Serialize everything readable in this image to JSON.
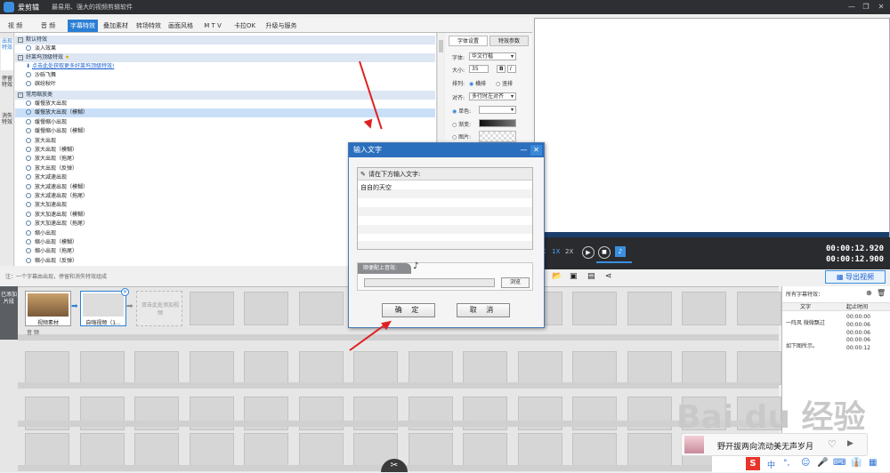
{
  "app": {
    "name": "爱剪辑",
    "slogan": "最易用、强大的视频剪辑软件"
  },
  "window_controls": [
    "—",
    "❐",
    "✕"
  ],
  "tabs": [
    "视 频",
    "音 频",
    "字幕特效",
    "叠加素材",
    "转场特效",
    "画面风格",
    "M T V",
    "卡拉OK",
    "升级与服务"
  ],
  "vtabs": [
    "出现特效",
    "停留特效",
    "消失特效"
  ],
  "effects": {
    "cat1": "默认特效",
    "cat1_items": [
      "淡入效果"
    ],
    "cat2": "好莱坞顶级特效",
    "cat2_link": "点击此处获取更多好莱坞顶级特效!",
    "cat2_items": [
      "沙砾飞舞",
      "缤纷秋叶"
    ],
    "cat3": "常用缩放类",
    "cat3_items": [
      "缓慢放大出现",
      "缓慢放大出现（模糊）",
      "缓慢缩小出现",
      "缓慢缩小出现（模糊）",
      "放大出现",
      "放大出现（模糊）",
      "放大出现（拖尾）",
      "放大出现（反弹）",
      "放大减速出现",
      "放大减速出现（模糊）",
      "放大减速出现（拖尾）",
      "放大加速出现",
      "放大加速出现（模糊）",
      "放大加速出现（拖尾）",
      "缩小出现",
      "缩小出现（模糊）",
      "缩小出现（拖尾）",
      "缩小出现（反弹）"
    ]
  },
  "settings": {
    "tab1": "字体设置",
    "tab2": "特效参数",
    "font_label": "字体:",
    "font_value": "华文行楷",
    "size_label": "大小:",
    "size_value": "35",
    "bold": "B",
    "italic": "I",
    "layout_label": "排列:",
    "h": "横排",
    "v": "竖排",
    "align_label": "对齐:",
    "align_value": "多行时左对齐",
    "color1": "单色:",
    "color2": "渐变:",
    "color3": "图片:"
  },
  "player": {
    "speeds": [
      "2X",
      "1X",
      "2X"
    ],
    "time1": "00:00:12.920",
    "time2": "00:00:12.900"
  },
  "tip": "注：一个字幕由出现，停留和消失特效组成",
  "export": "导出视频",
  "timeline": {
    "side": "已添加片段",
    "clip1": "视频素材",
    "clip2": "自嗨视频（1...",
    "addhint": "双击此处添加视频",
    "audio": "音 频"
  },
  "rightpanel": {
    "title": "所有字幕特效：",
    "col1": "文字",
    "col2": "起止时间",
    "rows": [
      {
        "text": "一阵风 微微飘过",
        "t1": "00:00:00",
        "t2": "00:00:06"
      },
      {
        "text": "",
        "t1": "00:00:06",
        "t2": ""
      },
      {
        "text": "如下图所示。",
        "t1": "00:00:06",
        "t2": "00:00:12"
      }
    ]
  },
  "dialog": {
    "title": "输入文字",
    "min": "—",
    "close": "✕",
    "prompt": "请在下方输入文字:",
    "text": "自自的天空",
    "music_label": "顺便配上音效:",
    "browse": "浏览",
    "ok": "确 定",
    "cancel": "取 消"
  },
  "notify": {
    "text": "野开拔两向流动美无声岁月"
  },
  "watermark": "Bai du 经验",
  "ime": [
    "中",
    "°,",
    "☺",
    "🎤",
    "⌨",
    "👔"
  ],
  "colors": {
    "accent": "#2a7fd4",
    "arrow": "#e02020"
  }
}
